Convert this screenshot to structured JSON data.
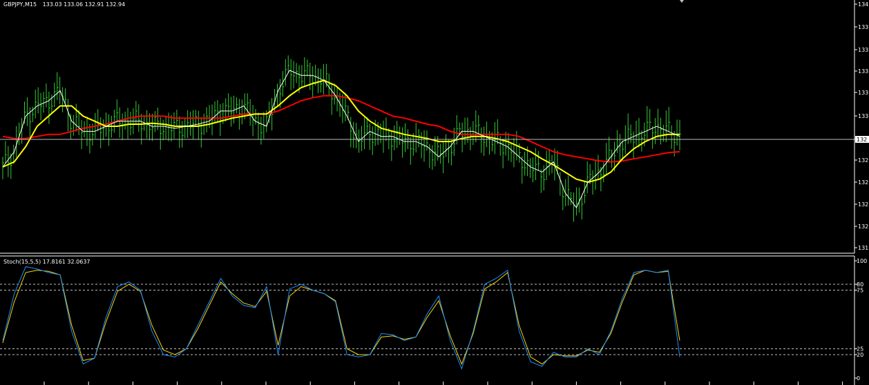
{
  "main_panel": {
    "symbol_timeframe": "GBPJPY,M15",
    "ohlc": "133.03 133.06 132.91 132.94",
    "y_tick_labels": [
      "134",
      "133",
      "133",
      "133",
      "133",
      "133",
      "132",
      "132",
      "132",
      "132",
      "132",
      "131"
    ],
    "current_price_label": "132",
    "price_line_color": "#c0c0c0",
    "colors": {
      "bars": "#32cd32",
      "fast_ma": "#ffffff",
      "mid_ma": "#ffff00",
      "slow_ma": "#ff0000"
    }
  },
  "stoch_panel": {
    "title": "Stoch(15,5,5) 17.8161 32.0637",
    "y_tick_labels": [
      "100",
      "80",
      "75",
      "25",
      "20",
      "0"
    ],
    "levels": [
      80,
      75,
      25,
      20
    ],
    "colors": {
      "main": "#1e90ff",
      "signal": "#ffd700",
      "levels": "#c0c0c0"
    }
  },
  "chart_data": [
    {
      "type": "line",
      "title": "GBPJPY,M15",
      "x_count": 60,
      "series": [
        {
          "values": [
            132.6,
            132.75,
            133.1,
            133.2,
            133.25,
            133.35,
            133.05,
            132.95,
            132.95,
            133.0,
            133.05,
            133.05,
            133.05,
            133.0,
            133.0,
            132.98,
            133.0,
            133.02,
            133.05,
            133.15,
            133.15,
            133.2,
            133.05,
            133.0,
            133.35,
            133.55,
            133.5,
            133.5,
            133.45,
            133.3,
            133.1,
            132.85,
            132.95,
            132.9,
            132.9,
            132.85,
            132.85,
            132.8,
            132.7,
            132.8,
            132.95,
            132.95,
            132.9,
            132.85,
            132.8,
            132.7,
            132.6,
            132.55,
            132.65,
            132.35,
            132.2,
            132.45,
            132.55,
            132.7,
            132.85,
            132.9,
            132.95,
            133.0,
            132.95,
            132.9
          ]
        },
        {
          "values": [
            132.6,
            132.65,
            132.8,
            133.0,
            133.1,
            133.2,
            133.2,
            133.1,
            133.05,
            133.0,
            133.0,
            133.02,
            133.02,
            133.03,
            133.02,
            133.0,
            133.0,
            133.0,
            133.02,
            133.05,
            133.08,
            133.1,
            133.12,
            133.12,
            133.2,
            133.3,
            133.38,
            133.42,
            133.45,
            133.4,
            133.3,
            133.15,
            133.05,
            132.98,
            132.95,
            132.92,
            132.9,
            132.88,
            132.85,
            132.85,
            132.88,
            132.9,
            132.9,
            132.88,
            132.85,
            132.8,
            132.75,
            132.68,
            132.62,
            132.55,
            132.48,
            132.45,
            132.48,
            132.55,
            132.68,
            132.78,
            132.85,
            132.9,
            132.92,
            132.92
          ]
        },
        {
          "values": [
            132.9,
            132.88,
            132.88,
            132.9,
            132.92,
            132.92,
            132.95,
            132.98,
            133.0,
            133.02,
            133.05,
            133.08,
            133.1,
            133.1,
            133.1,
            133.08,
            133.08,
            133.08,
            133.08,
            133.08,
            133.1,
            133.12,
            133.12,
            133.12,
            133.15,
            133.2,
            133.25,
            133.28,
            133.3,
            133.3,
            133.28,
            133.25,
            133.2,
            133.15,
            133.1,
            133.08,
            133.05,
            133.02,
            133.0,
            132.95,
            132.92,
            132.92,
            132.92,
            132.92,
            132.92,
            132.9,
            132.85,
            132.8,
            132.75,
            132.72,
            132.7,
            132.68,
            132.66,
            132.65,
            132.66,
            132.68,
            132.7,
            132.72,
            132.74,
            132.75
          ]
        }
      ]
    },
    {
      "type": "line",
      "title": "Stoch(15,5,5) 17.8161 32.0637",
      "x_count": 60,
      "ylim": [
        0,
        100
      ],
      "series": [
        {
          "values": [
            32,
            72,
            95,
            93,
            90,
            88,
            40,
            12,
            17,
            52,
            78,
            82,
            75,
            40,
            20,
            18,
            25,
            45,
            65,
            85,
            70,
            62,
            60,
            78,
            20,
            76,
            80,
            75,
            72,
            65,
            20,
            18,
            20,
            38,
            37,
            32,
            35,
            55,
            70,
            32,
            8,
            40,
            80,
            85,
            92,
            40,
            14,
            10,
            22,
            18,
            18,
            25,
            20,
            40,
            68,
            90,
            92,
            90,
            92,
            18
          ]
        },
        {
          "values": [
            30,
            65,
            90,
            92,
            91,
            88,
            45,
            15,
            17,
            48,
            74,
            80,
            74,
            45,
            24,
            20,
            25,
            42,
            62,
            82,
            72,
            64,
            61,
            74,
            28,
            70,
            78,
            75,
            72,
            66,
            25,
            20,
            20,
            35,
            36,
            33,
            35,
            52,
            66,
            36,
            12,
            38,
            76,
            82,
            90,
            45,
            18,
            12,
            20,
            19,
            19,
            24,
            22,
            38,
            65,
            88,
            92,
            90,
            91,
            32
          ]
        }
      ]
    }
  ]
}
